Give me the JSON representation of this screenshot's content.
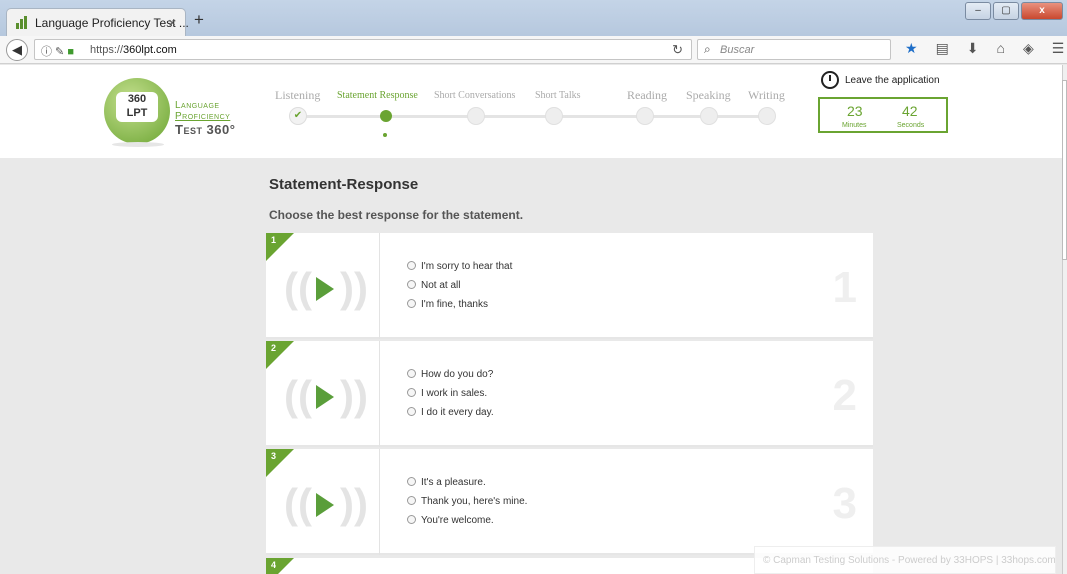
{
  "browser": {
    "tab_title": "Language Proficiency Test ...",
    "tab_close": "×",
    "new_tab": "+",
    "url_prefix": "https://",
    "url_host": "360lpt.com",
    "search_placeholder": "Buscar",
    "window_buttons": [
      "–",
      "▢",
      "x"
    ]
  },
  "logo": {
    "line1": "360",
    "line2": "LPT",
    "text1": "Language",
    "text2": "Proficiency",
    "text3": "Test 360°"
  },
  "steps": [
    {
      "label": "Listening",
      "state": "done"
    },
    {
      "label": "Statement Response",
      "state": "active"
    },
    {
      "label": "Short Conversations",
      "state": "upcoming"
    },
    {
      "label": "Short Talks",
      "state": "upcoming"
    },
    {
      "label": "Reading",
      "state": "upcoming"
    },
    {
      "label": "Speaking",
      "state": "upcoming"
    },
    {
      "label": "Writing",
      "state": "upcoming"
    }
  ],
  "leave_label": "Leave the application",
  "timer": {
    "minutes": "23",
    "minutes_label": "Minutes",
    "seconds": "42",
    "seconds_label": "Seconds"
  },
  "section_title": "Statement-Response",
  "instruction": "Choose the best response for the statement.",
  "questions": [
    {
      "number": "1",
      "options": [
        "I'm sorry to hear that",
        "Not at all",
        "I'm fine, thanks"
      ]
    },
    {
      "number": "2",
      "options": [
        "How do you do?",
        "I work in sales.",
        "I do it every day."
      ]
    },
    {
      "number": "3",
      "options": [
        "It's a pleasure.",
        "Thank you, here's mine.",
        "You're welcome."
      ]
    },
    {
      "number": "4",
      "options": []
    }
  ],
  "footer": "© Capman Testing Solutions - Powered by 33HOPS | 33hops.com",
  "colors": {
    "accent": "#6aa431",
    "play": "#5a9e3a",
    "page_bg": "#e9e9e9"
  }
}
